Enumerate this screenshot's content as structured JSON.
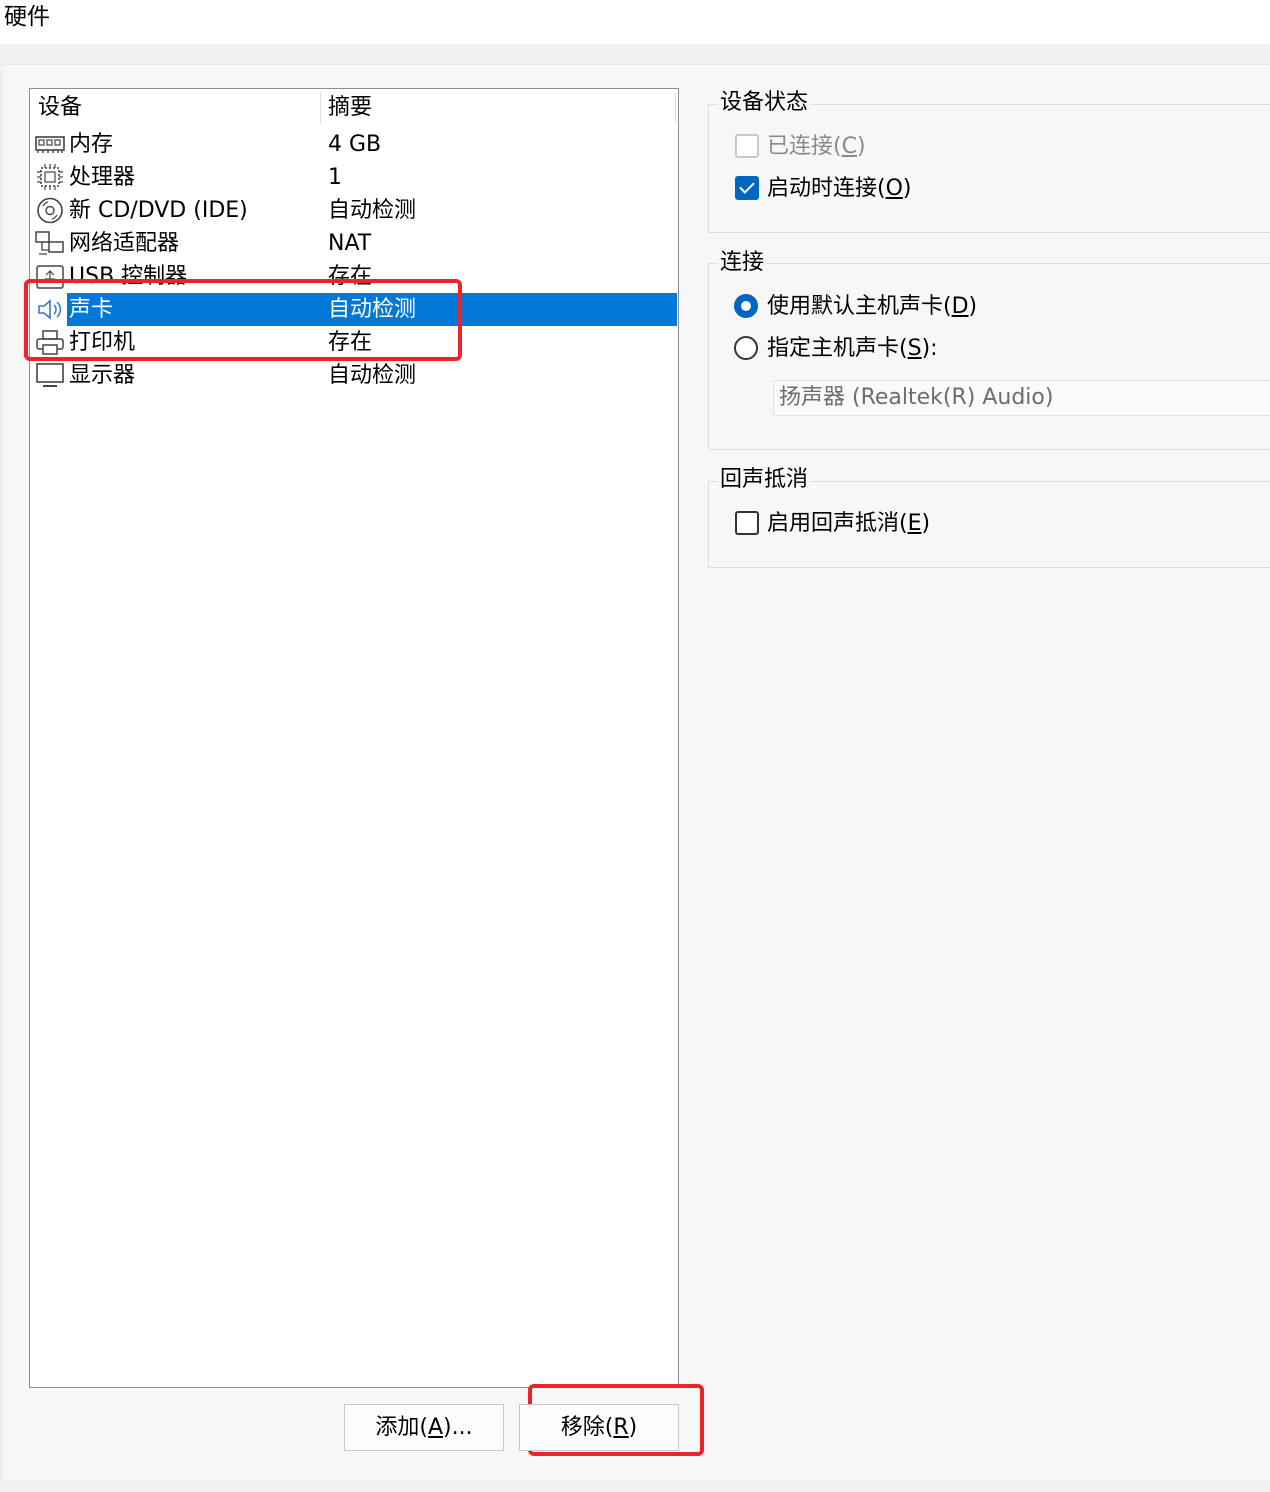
{
  "window": {
    "title": "硬件"
  },
  "device_list": {
    "columns": {
      "device": "设备",
      "summary": "摘要"
    },
    "items": [
      {
        "icon": "memory-icon",
        "name": "内存",
        "summary": "4 GB"
      },
      {
        "icon": "processor-icon",
        "name": "处理器",
        "summary": "1"
      },
      {
        "icon": "cd-dvd-icon",
        "name": "新 CD/DVD (IDE)",
        "summary": "自动检测"
      },
      {
        "icon": "network-adapter-icon",
        "name": "网络适配器",
        "summary": "NAT"
      },
      {
        "icon": "usb-controller-icon",
        "name": "USB 控制器",
        "summary": "存在"
      },
      {
        "icon": "speaker-icon",
        "name": "声卡",
        "summary": "自动检测",
        "selected": true
      },
      {
        "icon": "printer-icon",
        "name": "打印机",
        "summary": "存在"
      },
      {
        "icon": "display-icon",
        "name": "显示器",
        "summary": "自动检测"
      }
    ]
  },
  "buttons": {
    "add": {
      "label": "添加(",
      "mnemonic": "A",
      "suffix": ")..."
    },
    "remove": {
      "label": "移除(",
      "mnemonic": "R",
      "suffix": ")"
    }
  },
  "device_status": {
    "title": "设备状态",
    "connected": {
      "label": "已连接(",
      "mnemonic": "C",
      "suffix": ")",
      "checked": false,
      "disabled": true
    },
    "connect_at_power_on": {
      "label": "启动时连接(",
      "mnemonic": "O",
      "suffix": ")",
      "checked": true
    }
  },
  "connection": {
    "title": "连接",
    "use_default": {
      "label": "使用默认主机声卡(",
      "mnemonic": "D",
      "suffix": ")",
      "selected": true
    },
    "specify": {
      "label": "指定主机声卡(",
      "mnemonic": "S",
      "suffix": "):",
      "selected": false
    },
    "device_select_value": "扬声器 (Realtek(R) Audio)"
  },
  "echo_cancel": {
    "title": "回声抵消",
    "enable": {
      "label": "启用回声抵消(",
      "mnemonic": "E",
      "suffix": ")",
      "checked": false
    }
  },
  "colors": {
    "selection": "#0078d7",
    "highlight_box": "#e8262a",
    "accent": "#0067c0"
  }
}
